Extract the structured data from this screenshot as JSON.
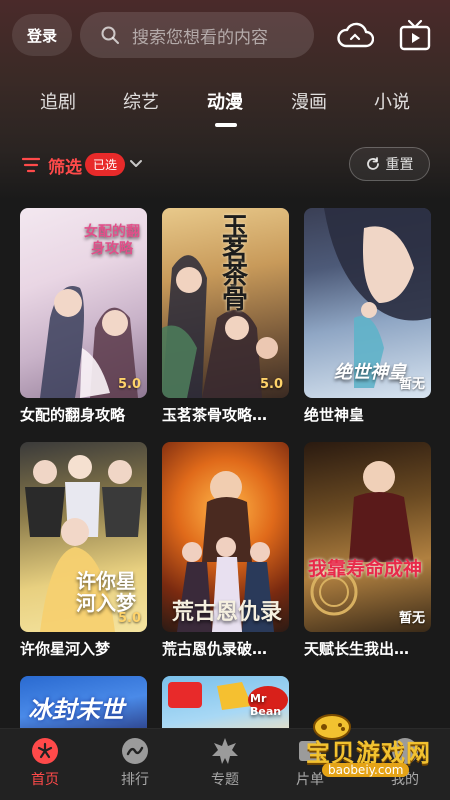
{
  "header": {
    "login_label": "登录",
    "search_placeholder": "搜索您想看的内容",
    "icons": [
      "search-icon",
      "cloud-icon",
      "tv-icon"
    ]
  },
  "tabs": [
    {
      "label": "追剧",
      "active": false
    },
    {
      "label": "综艺",
      "active": false
    },
    {
      "label": "动漫",
      "active": true
    },
    {
      "label": "漫画",
      "active": false
    },
    {
      "label": "小说",
      "active": false
    }
  ],
  "filter": {
    "label": "筛选",
    "badge": "已选",
    "reset_label": "重置"
  },
  "cards": [
    {
      "title": "女配的翻身攻略",
      "score": "5.0",
      "cover_text": "女配的翻身攻略"
    },
    {
      "title": "玉茗茶骨攻略…",
      "score": "5.0",
      "cover_text": "玉茗茶骨"
    },
    {
      "title": "绝世神皇",
      "score": "暂无",
      "cover_text": "绝世神皇"
    },
    {
      "title": "许你星河入梦",
      "score": "5.0",
      "cover_text": "许你星河入梦"
    },
    {
      "title": "荒古恩仇录破…",
      "score": "",
      "cover_text": "荒古恩仇录"
    },
    {
      "title": "天赋长生我出…",
      "score": "暂无",
      "cover_text": "我靠寿命成神"
    },
    {
      "title": "",
      "score": "",
      "cover_text": "冰封末世"
    },
    {
      "title": "",
      "score": "",
      "cover_text": "Mr Bean"
    }
  ],
  "bottom_nav": [
    {
      "label": "首页",
      "icon": "home-icon",
      "active": true
    },
    {
      "label": "排行",
      "icon": "ranking-icon",
      "active": false
    },
    {
      "label": "专题",
      "icon": "topic-icon",
      "active": false
    },
    {
      "label": "片单",
      "icon": "playlist-icon",
      "active": false
    },
    {
      "label": "我的",
      "icon": "profile-icon",
      "active": false
    }
  ],
  "watermark": {
    "text": "宝贝游戏网",
    "url": "baobeiy.com"
  },
  "colors": {
    "accent": "#ff4a4a",
    "background": "#1a1a1a",
    "nav_bg": "#222222"
  }
}
